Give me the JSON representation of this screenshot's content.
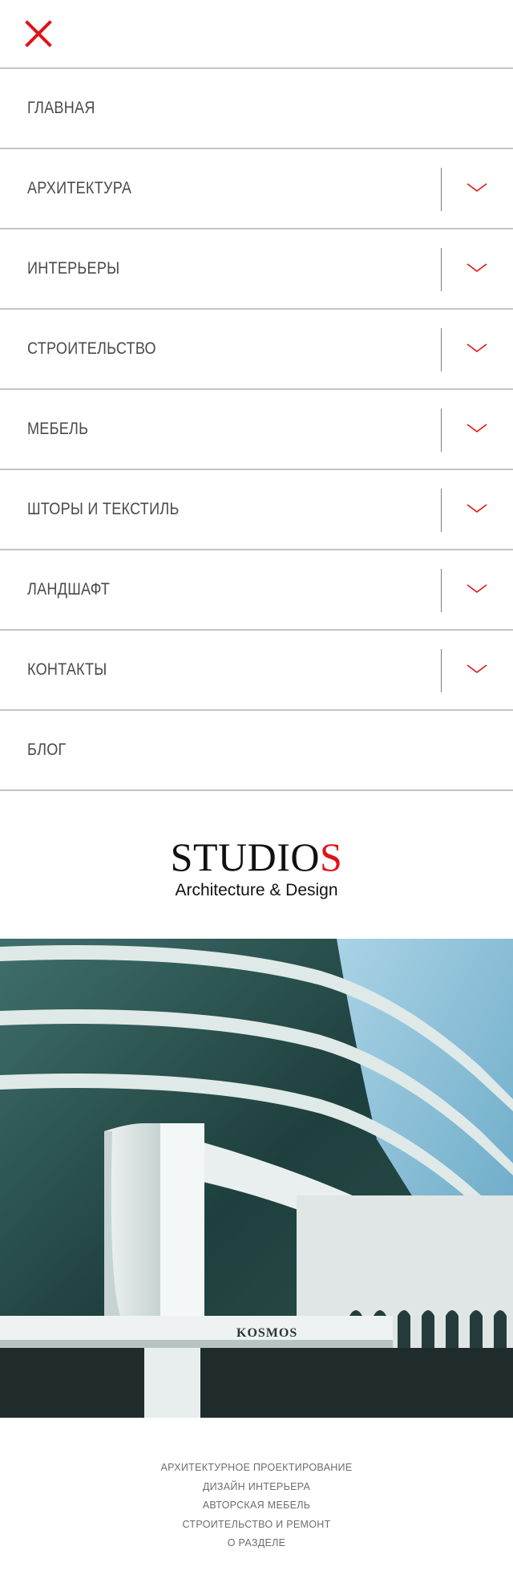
{
  "header": {
    "close_label": "close"
  },
  "menu": {
    "items": [
      {
        "label": "ГЛАВНАЯ"
      },
      {
        "label": "АРХИТЕКТУРА"
      },
      {
        "label": "ИНТЕРЬЕРЫ"
      },
      {
        "label": "СТРОИТЕЛЬСТВО"
      },
      {
        "label": "МЕБЕЛЬ"
      },
      {
        "label": "ШТОРЫ И ТЕКСТИЛЬ"
      },
      {
        "label": "ЛАНДШАФТ"
      },
      {
        "label": "КОНТАКТЫ"
      },
      {
        "label": "БЛОГ"
      }
    ]
  },
  "logo": {
    "main_prefix": "STUDIO",
    "main_suffix": "S",
    "subtitle": "Architecture & Design"
  },
  "hero": {
    "sign_text": "KOSMOS"
  },
  "footer": {
    "links": [
      "АРХИТЕКТУРНОЕ ПРОЕКТИРОВАНИЕ",
      "ДИЗАЙН ИНТЕРЬЕРА",
      "АВТОРСКАЯ МЕБЕЛЬ",
      "СТРОИТЕЛЬСТВО И РЕМОНТ",
      "О РАЗДЕЛЕ"
    ]
  },
  "colors": {
    "accent": "#e2121a",
    "divider": "#c4c4c4",
    "text": "#4a4a4a"
  },
  "icons": {
    "close": "close-icon",
    "expand": "chevron-down-icon"
  }
}
